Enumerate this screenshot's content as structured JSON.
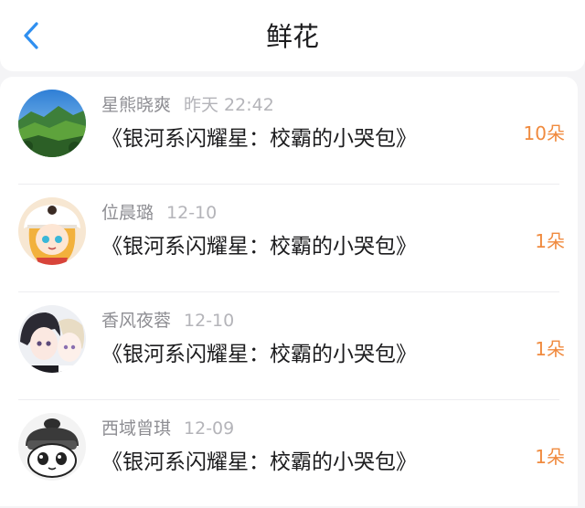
{
  "header": {
    "title": "鲜花",
    "back_icon": "chevron-left-icon",
    "accent": "#2f8ff0"
  },
  "list": {
    "count_color": "#f08a3e",
    "items": [
      {
        "name": "星熊晓爽",
        "time": "昨天 22:42",
        "book": "《银河系闪耀星：校霸的小哭包》",
        "count": "10朵",
        "avatar": "landscape-avatar"
      },
      {
        "name": "位晨璐",
        "time": "12-10",
        "book": "《银河系闪耀星：校霸的小哭包》",
        "count": "1朵",
        "avatar": "anime-girl-avatar"
      },
      {
        "name": "香风夜蓉",
        "time": "12-10",
        "book": "《银河系闪耀星：校霸的小哭包》",
        "count": "1朵",
        "avatar": "anime-boys-avatar"
      },
      {
        "name": "西域曾琪",
        "time": "12-09",
        "book": "《银河系闪耀星：校霸的小哭包》",
        "count": "1朵",
        "avatar": "chibi-character-avatar"
      }
    ]
  }
}
